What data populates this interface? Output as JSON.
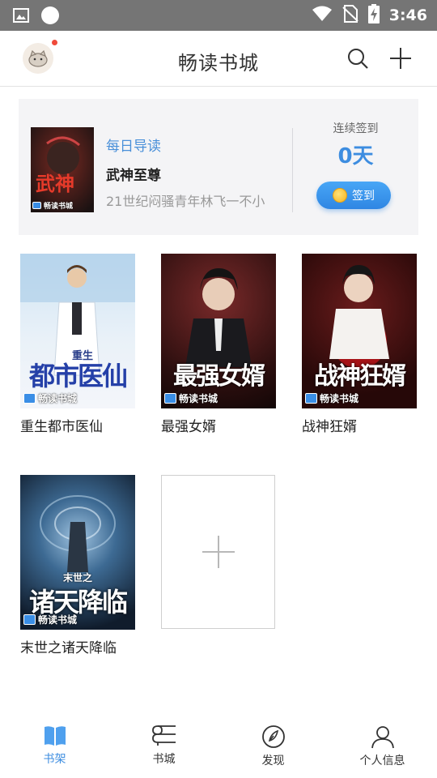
{
  "status_bar": {
    "time": "3:46"
  },
  "header": {
    "title": "畅读书城"
  },
  "daily": {
    "kicker": "每日导读",
    "book_title": "武神至尊",
    "description": "21世纪闷骚青年林飞一不小",
    "cover_title": "武神",
    "checkin_label": "连续签到",
    "checkin_days": "0天",
    "checkin_button": "签到"
  },
  "publisher": "畅读书城",
  "books": [
    {
      "name": "重生都市医仙",
      "cover_title": "都市医仙",
      "cover_sub": "重生"
    },
    {
      "name": "最强女婿",
      "cover_title": "最强女婿",
      "cover_sub": ""
    },
    {
      "name": "战神狂婿",
      "cover_title": "战神狂婿",
      "cover_sub": ""
    },
    {
      "name": "末世之诸天降临",
      "cover_title": "诸天降临",
      "cover_sub": "末世之"
    }
  ],
  "nav": [
    {
      "label": "书架",
      "icon": "book-open-icon",
      "active": true
    },
    {
      "label": "书城",
      "icon": "bookstore-icon",
      "active": false
    },
    {
      "label": "发现",
      "icon": "compass-icon",
      "active": false
    },
    {
      "label": "个人信息",
      "icon": "person-icon",
      "active": false
    }
  ],
  "colors": {
    "accent": "#3d8de0",
    "status_bar": "#757575",
    "card_bg": "#f4f4f6"
  }
}
